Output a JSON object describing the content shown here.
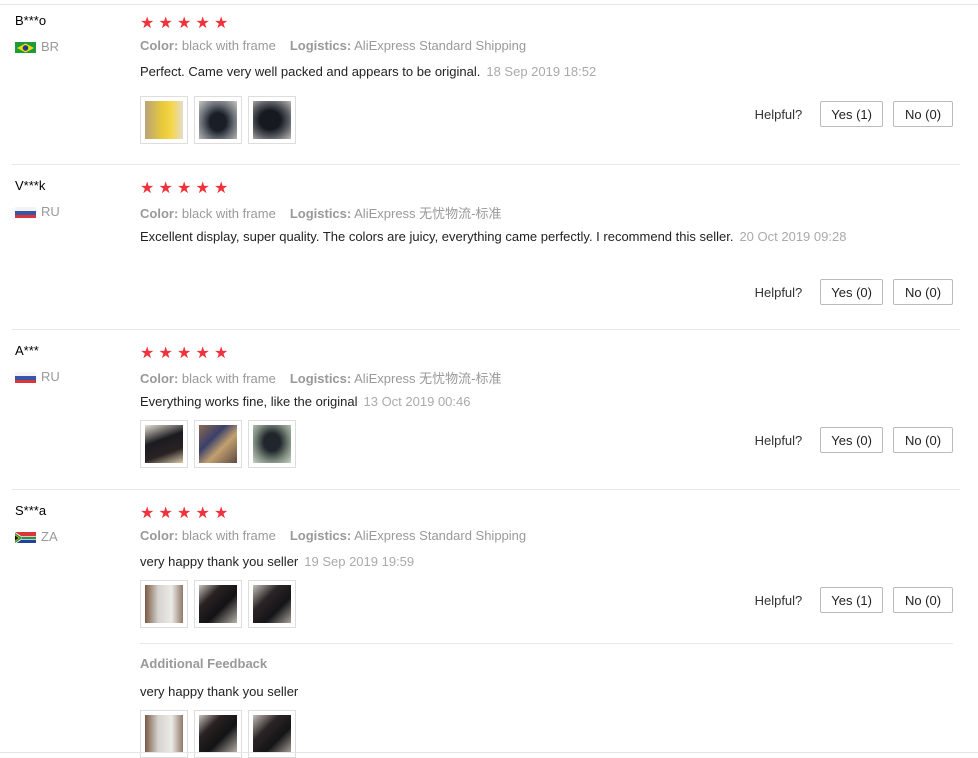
{
  "reviews": [
    {
      "user": "B***o",
      "country": "BR",
      "color_label": "Color:",
      "color_value": "black with frame",
      "logistics_label": "Logistics:",
      "logistics_value": "AliExpress Standard Shipping",
      "text": "Perfect. Came very well packed and appears to be original.",
      "date": "18 Sep 2019 18:52",
      "rating": 5,
      "photos": [
        "photo-1",
        "photo-2",
        "photo-3"
      ],
      "helpful_label": "Helpful?",
      "yes": "Yes (1)",
      "no": "No (0)"
    },
    {
      "user": "V***k",
      "country": "RU",
      "color_label": "Color:",
      "color_value": "black with frame",
      "logistics_label": "Logistics:",
      "logistics_value": "AliExpress 无忧物流-标准",
      "text": "Excellent display, super quality. The colors are juicy, everything came perfectly. I recommend this seller.",
      "date": "20 Oct 2019 09:28",
      "rating": 5,
      "photos": [],
      "helpful_label": "Helpful?",
      "yes": "Yes (0)",
      "no": "No (0)"
    },
    {
      "user": "A***",
      "country": "RU",
      "color_label": "Color:",
      "color_value": "black with frame",
      "logistics_label": "Logistics:",
      "logistics_value": "AliExpress 无忧物流-标准",
      "text": "Everything works fine, like the original",
      "date": "13 Oct 2019 00:46",
      "rating": 5,
      "photos": [
        "photo-1",
        "photo-2",
        "photo-3"
      ],
      "helpful_label": "Helpful?",
      "yes": "Yes (0)",
      "no": "No (0)"
    },
    {
      "user": "S***a",
      "country": "ZA",
      "color_label": "Color:",
      "color_value": "black with frame",
      "logistics_label": "Logistics:",
      "logistics_value": "AliExpress Standard Shipping",
      "text": "very happy thank you seller",
      "date": "19 Sep 2019 19:59",
      "rating": 5,
      "photos": [
        "photo-1",
        "photo-2",
        "photo-3"
      ],
      "helpful_label": "Helpful?",
      "yes": "Yes (1)",
      "no": "No (0)",
      "additional_feedback_title": "Additional Feedback",
      "additional_feedback_text": "very happy thank you seller",
      "additional_photos": [
        "photo-1",
        "photo-2",
        "photo-3"
      ]
    }
  ],
  "colors": {
    "star": "#f0333b",
    "muted": "#999999",
    "divider": "#e8e8e8"
  }
}
